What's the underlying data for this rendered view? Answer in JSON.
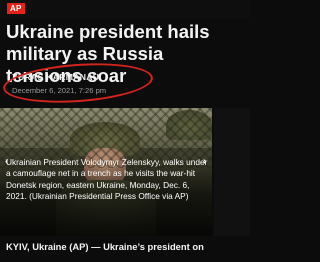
{
  "brand": {
    "logo_text": "AP",
    "logo_color": "#e2231a"
  },
  "article": {
    "headline": "Ukraine president hails military as Russia tensions soar",
    "author": "YURAS KARMANAU",
    "date": "December 6, 2021, 7:26 pm",
    "annotation_color": "#d3241d"
  },
  "photo": {
    "caption": "Ukrainian President Volodymyr Zelenskyy, walks under a camouflage net in a trench as he visits the war-hit Donetsk region, eastern Ukraine, Monday, Dec. 6, 2021. (Ukrainian Presidential Press Office via AP)",
    "prev_icon": "‹",
    "next_icon": "›"
  },
  "lede": "KYIV, Ukraine (AP) — Ukraine’s president on"
}
